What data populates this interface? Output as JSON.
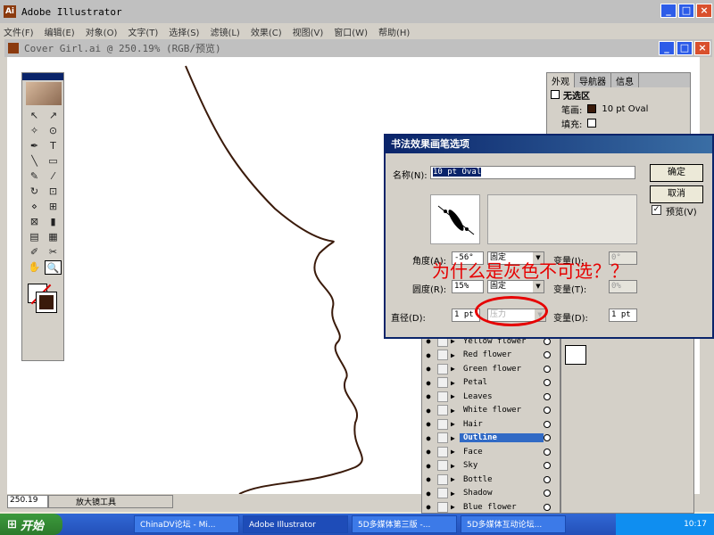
{
  "app": {
    "title": "Adobe Illustrator",
    "logo": "Ai"
  },
  "menu": [
    "文件(F)",
    "编辑(E)",
    "对象(O)",
    "文字(T)",
    "选择(S)",
    "滤镜(L)",
    "效果(C)",
    "视图(V)",
    "窗口(W)",
    "帮助(H)"
  ],
  "document": {
    "title": "Cover Girl.ai @ 250.19% (RGB/预览)"
  },
  "toolbox": {
    "tools": [
      "↖",
      "↗",
      "✧",
      "⊙",
      "✒",
      "T",
      "╲",
      "▭",
      "✎",
      "⁄",
      "↻",
      "⊡",
      "⋄",
      "⊞",
      "⊠",
      "▮",
      "▤",
      "▦",
      "✐",
      "✂",
      "✋",
      "🔍"
    ]
  },
  "appearance_panel": {
    "tabs": [
      "外观",
      "导航器",
      "信息"
    ],
    "selection": "无选区",
    "stroke_label": "笔画:",
    "stroke_value": "10 pt Oval",
    "fill_label": "填充:"
  },
  "dialog": {
    "title": "书法效果画笔选项",
    "name_label": "名称(N):",
    "name_value": "10 pt Oval",
    "ok_label": "确定",
    "cancel_label": "取消",
    "preview_label": "预览(V)",
    "preview_checked": "✓",
    "angle_label": "角度(A):",
    "angle_value": "-56°",
    "angle_mode": "固定",
    "angle_var_label": "变量(I):",
    "angle_var_value": "0°",
    "round_label": "圆度(R):",
    "round_value": "15%",
    "round_mode": "固定",
    "round_var_label": "变量(T):",
    "round_var_value": "0%",
    "diam_label": "直径(D):",
    "diam_value": "1 pt",
    "diam_mode": "压力",
    "diam_var_label": "变量(D):",
    "diam_var_value": "1 pt"
  },
  "annotation": "为什么是灰色不可选？？",
  "layers": [
    {
      "name": "Yellow flower",
      "selected": false
    },
    {
      "name": "Red flower",
      "selected": false
    },
    {
      "name": "Green flower",
      "selected": false
    },
    {
      "name": "Petal",
      "selected": false
    },
    {
      "name": "Leaves",
      "selected": false
    },
    {
      "name": "White flower",
      "selected": false
    },
    {
      "name": "Hair",
      "selected": false
    },
    {
      "name": "Outline",
      "selected": true
    },
    {
      "name": "Face",
      "selected": false
    },
    {
      "name": "Sky",
      "selected": false
    },
    {
      "name": "Bottle",
      "selected": false
    },
    {
      "name": "Shadow",
      "selected": false
    },
    {
      "name": "Blue flower",
      "selected": false
    }
  ],
  "status": {
    "zoom": "250.19",
    "tool": "放大镜工具"
  },
  "taskbar": {
    "start": "开始",
    "tasks": [
      "ChinaDV论坛 - Mi...",
      "Adobe Illustrator",
      "5D多媒体第三版 -...",
      "5D多媒体互动论坛..."
    ],
    "time": "10:17"
  },
  "colors": {
    "accent": "#0a246a",
    "stroke": "#3a1a0a",
    "annotation": "#e60000"
  }
}
